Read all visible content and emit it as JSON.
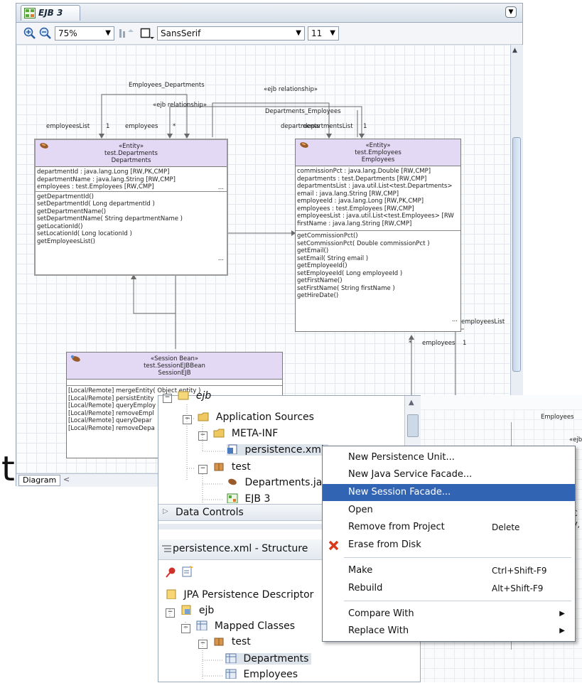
{
  "editor": {
    "tab_title": "EJB 3",
    "zoom": "75%",
    "font_name": "SansSerif",
    "font_size": "11",
    "bottom_tab": "Diagram"
  },
  "diagram": {
    "labels": {
      "employees_departments": "Employees_Departments",
      "ejb_rel_1": "«ejb relationship»",
      "ejb_rel_2": "«ejb relationship»",
      "departments_employees": "Departments_Employees",
      "employees_list_left": "employeesList",
      "one_left": "1",
      "employees_left": "employees",
      "star_left": "*",
      "departments_right": "departments",
      "departments_list_right": "departmentsList",
      "one_right": "1",
      "star_bottom": "*",
      "employees_bottom": "employees",
      "one_bottom": "1",
      "employees_list_far": "employeesList"
    },
    "departments": {
      "stereotype": "«Entity»",
      "class": "test.Departments",
      "name": "Departments",
      "attributes": [
        "departmentId : java.lang.Long [RW,PK,CMP]",
        "departmentName : java.lang.String [RW,CMP]",
        "employees : test.Employees [RW,CMP]"
      ],
      "methods": [
        "getDepartmentId()",
        "setDepartmentId( Long departmentId )",
        "getDepartmentName()",
        "setDepartmentName( String departmentName )",
        "getLocationId()",
        "setLocationId( Long locationId )",
        "getEmployeesList()"
      ]
    },
    "employees": {
      "stereotype": "«Entity»",
      "class": "test.Employees",
      "name": "Employees",
      "attributes": [
        "commissionPct : java.lang.Double [RW,CMP]",
        "departments : test.Departments [RW,CMP]",
        "departmentsList : java.util.List<test.Departments>",
        "email : java.lang.String [RW,CMP]",
        "employeeId : java.lang.Long [RW,PK,CMP]",
        "employees : test.Employees [RW,CMP]",
        "employeesList : java.util.List<test.Employees> [RW",
        "firstName : java.lang.String [RW,CMP]"
      ],
      "methods": [
        "getCommissionPct()",
        "setCommissionPct( Double commissionPct )",
        "getEmail()",
        "setEmail( String email )",
        "getEmployeeId()",
        "setEmployeeId( Long employeeId )",
        "getFirstName()",
        "setFirstName( String firstName )",
        "getHireDate()"
      ]
    },
    "session": {
      "stereotype": "«Session Bean»",
      "class": "test.SessionEJBBean",
      "name": "SessionEJB",
      "methods": [
        "[Local/Remote] mergeEntity( Object entity )",
        "[Local/Remote] persistEntity",
        "[Local/Remote] queryEmploy",
        "[Local/Remote] removeEmpl",
        "[Local/Remote] queryDepar",
        "[Local/Remote] removeDepa"
      ]
    },
    "ellipsis": "..."
  },
  "navigator": {
    "rows": [
      {
        "label": "ejb"
      },
      {
        "label": "Application Sources"
      },
      {
        "label": "META-INF"
      },
      {
        "label": "persistence.xml"
      },
      {
        "label": "test"
      },
      {
        "label": "Departments.java"
      },
      {
        "label": "EJB 3"
      }
    ],
    "data_controls": "Data Controls"
  },
  "structure": {
    "title": "persistence.xml - Structure",
    "rows": [
      {
        "label": "JPA Persistence Descriptor"
      },
      {
        "label": "ejb"
      },
      {
        "label": "Mapped Classes"
      },
      {
        "label": "test"
      },
      {
        "label": "Departments"
      },
      {
        "label": "Employees"
      }
    ]
  },
  "right_window": {
    "label": "Employees",
    "label2": "«ejb",
    "frag1": "C",
    "frag2": "V,"
  },
  "context_menu": {
    "items": [
      {
        "label": "New Persistence Unit..."
      },
      {
        "label": "New Java Service Facade..."
      },
      {
        "label": "New Session Facade..."
      },
      {
        "label": "Open"
      },
      {
        "label": "Remove from Project",
        "shortcut": "Delete"
      },
      {
        "label": "Erase from Disk"
      },
      {
        "label": "Make",
        "shortcut": "Ctrl+Shift-F9"
      },
      {
        "label": "Rebuild",
        "shortcut": "Alt+Shift-F9"
      },
      {
        "label": "Compare With"
      },
      {
        "label": "Replace With"
      }
    ]
  },
  "background_text": "t",
  "colors": {
    "menu_selection": "#3264b4",
    "entity_header": "#e3d9f5"
  }
}
